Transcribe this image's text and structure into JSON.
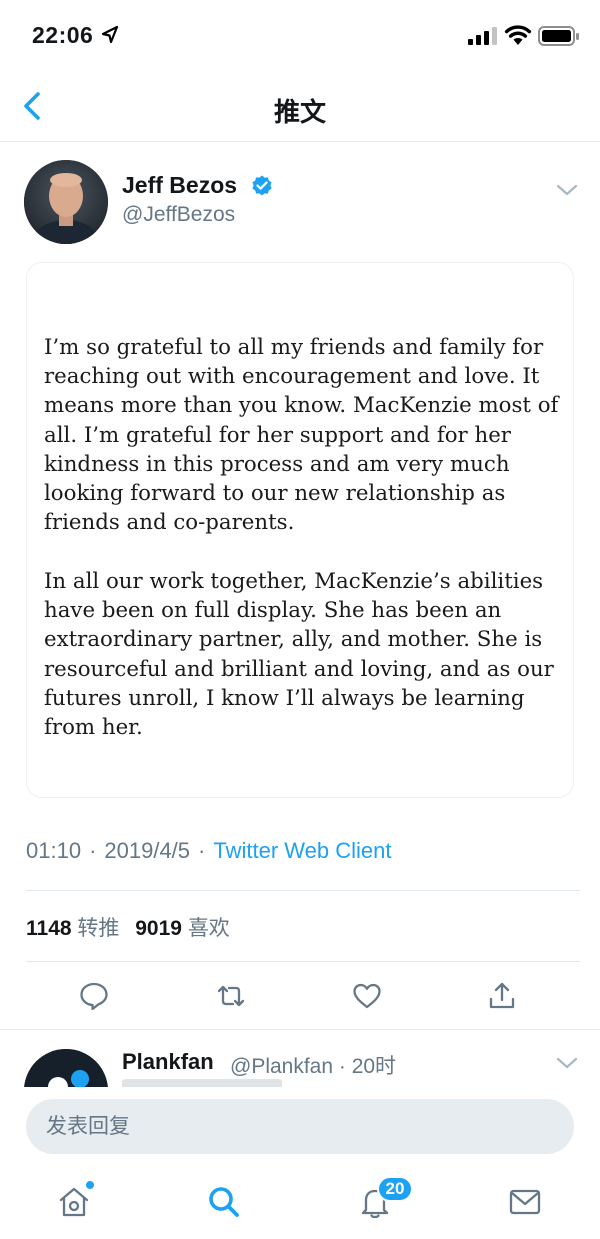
{
  "status_bar": {
    "time": "22:06"
  },
  "nav": {
    "title": "推文"
  },
  "tweet": {
    "author_name": "Jeff Bezos",
    "author_handle": "@JeffBezos",
    "letter_paragraphs": [
      "I’m so grateful to all my friends and family for reaching out with encouragement and love. It means more than you know. MacKenzie most of all. I’m grateful for her support and for her kindness in this process and am very much looking forward to our new relationship as friends and co-parents.",
      "In all our work together, MacKenzie’s abilities have been on full display. She has been an extraordinary partner, ally, and mother. She is resourceful and brilliant and loving, and as our futures unroll, I know I’ll always be learning from her."
    ],
    "time": "01:10",
    "date": "2019/4/5",
    "separator": "·",
    "client": "Twitter Web Client",
    "retweet_count": "1148",
    "retweet_label": "转推",
    "like_count": "9019",
    "like_label": "喜欢"
  },
  "reply_preview": {
    "name": "Plankfan",
    "handle_time": "@Plankfan · 20时"
  },
  "compose": {
    "placeholder": "发表回复"
  },
  "tab_bar": {
    "notification_count": "20"
  },
  "colors": {
    "accent": "#1da1f2",
    "secondary_text": "#657786",
    "divider": "#e1e8ed"
  }
}
